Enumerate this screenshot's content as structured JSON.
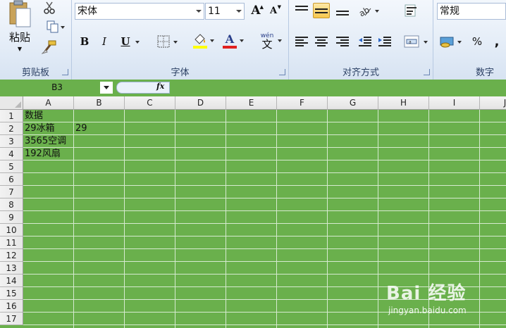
{
  "ribbon": {
    "clipboard": {
      "paste_label": "粘贴",
      "group_label": "剪贴板"
    },
    "font": {
      "font_name": "宋体",
      "font_size": "11",
      "bold": "B",
      "italic": "I",
      "underline": "U",
      "grow_font": "A",
      "shrink_font": "A",
      "font_color_glyph": "A",
      "phonetic_glyph": "wén",
      "group_label": "字体"
    },
    "alignment": {
      "group_label": "对齐方式"
    },
    "number": {
      "format": "常规",
      "percent": "%",
      "comma": ",",
      "group_label": "数字"
    }
  },
  "formula_bar": {
    "name_box": "B3",
    "fx_label": "fx",
    "formula": ""
  },
  "grid": {
    "columns": [
      "A",
      "B",
      "C",
      "D",
      "E",
      "F",
      "G",
      "H",
      "I",
      "J"
    ],
    "rows": [
      "1",
      "2",
      "3",
      "4",
      "5",
      "6",
      "7",
      "8",
      "9",
      "10",
      "11",
      "12",
      "13",
      "14",
      "15",
      "16",
      "17"
    ],
    "cells": {
      "A1": "数据",
      "A2": "29冰箱",
      "B2": "29",
      "A3": "3565空调",
      "A4": "192风扇"
    }
  },
  "watermark": {
    "logo": "Bai 经验",
    "url": "jingyan.baidu.com"
  },
  "colors": {
    "sheet_bg": "#6ab04c",
    "ribbon_bg": "#dfe9f5",
    "font_color_bar": "#e02020",
    "highlight_bar": "#ffff00"
  }
}
